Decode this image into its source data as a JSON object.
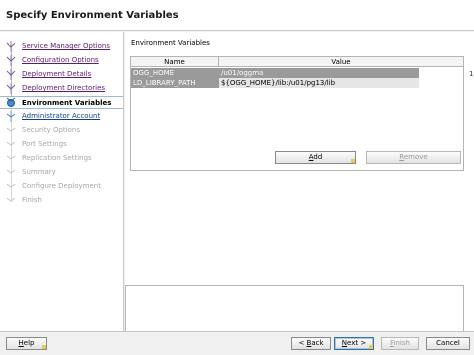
{
  "window": {
    "title": "Specify Environment Variables"
  },
  "steps": [
    {
      "label": "Service Manager Options",
      "state": "link"
    },
    {
      "label": "Configuration Options",
      "state": "link"
    },
    {
      "label": "Deployment Details",
      "state": "link"
    },
    {
      "label": "Deployment Directories",
      "state": "link"
    },
    {
      "label": "Environment Variables",
      "state": "active"
    },
    {
      "label": "Administrator Account",
      "state": "next"
    },
    {
      "label": "Security Options",
      "state": "disabled"
    },
    {
      "label": "Port Settings",
      "state": "disabled"
    },
    {
      "label": "Replication Settings",
      "state": "disabled"
    },
    {
      "label": "Summary",
      "state": "disabled"
    },
    {
      "label": "Configure Deployment",
      "state": "disabled"
    },
    {
      "label": "Finish",
      "state": "disabled"
    }
  ],
  "env": {
    "section_label": "Environment Variables",
    "columns": [
      "Name",
      "Value"
    ],
    "rows": [
      {
        "name": "OGG_HOME",
        "value": "/u01/oggma"
      },
      {
        "name": "LD_LIBRARY_PATH",
        "value": "${OGG_HOME}/lib:/u01/pg13/lib"
      }
    ],
    "scroll_mark": "1"
  },
  "buttons": {
    "add": {
      "mnemonic": "A",
      "rest": "dd",
      "enabled": true
    },
    "remove": {
      "mnemonic": "R",
      "rest": "emove",
      "enabled": false
    }
  },
  "footer": {
    "help": {
      "mnemonic": "H",
      "rest": "elp"
    },
    "back": {
      "prefix": "< ",
      "mnemonic": "B",
      "rest": "ack"
    },
    "next": {
      "mnemonic": "N",
      "rest": "ext >"
    },
    "finish": {
      "mnemonic": "F",
      "rest": "inish"
    },
    "cancel": "Cancel"
  },
  "colors": {
    "visited_link": "#5b1b6e",
    "next_link": "#14408a",
    "disabled_text": "#a6a6a6",
    "selected_row": "#9a9a9a"
  }
}
